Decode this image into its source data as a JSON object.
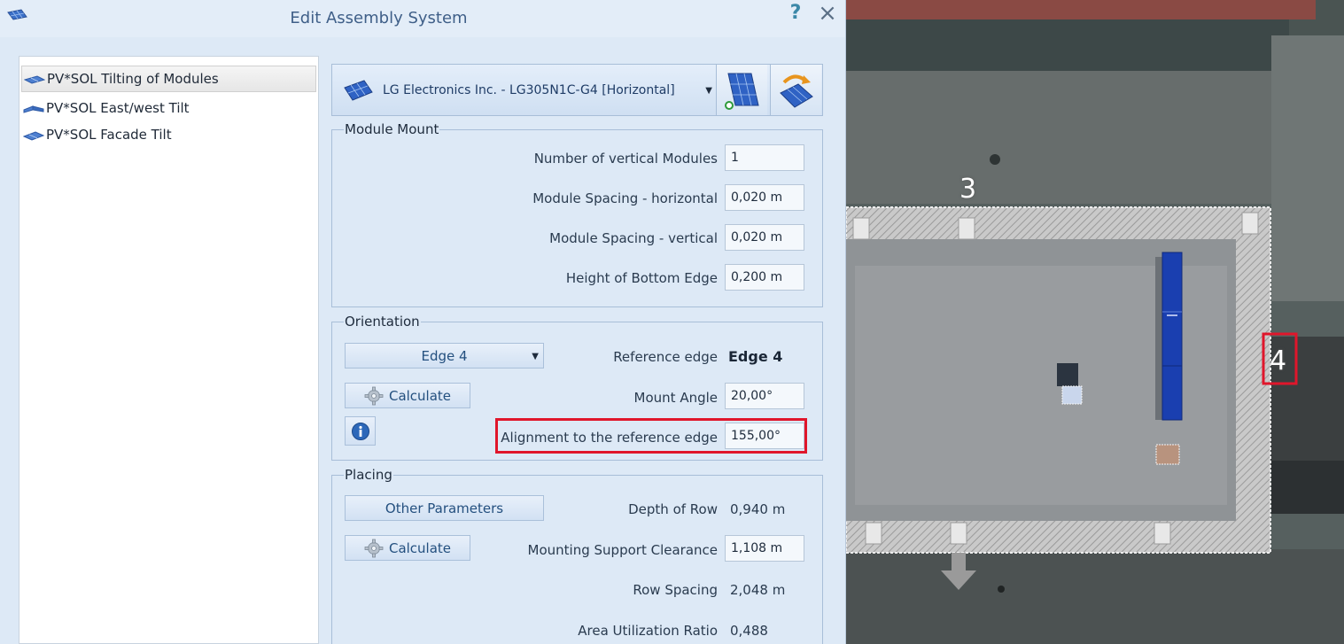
{
  "window": {
    "title": "Edit Assembly System",
    "help_label": "?",
    "close_label": "×"
  },
  "sidebar": {
    "items": [
      {
        "label": "PV*SOL Tilting of Modules",
        "selected": true
      },
      {
        "label": "PV*SOL East/west Tilt",
        "selected": false
      },
      {
        "label": "PV*SOL Facade Tilt",
        "selected": false
      }
    ]
  },
  "module": {
    "selected": "LG Electronics Inc. - LG305N1C-G4 [Horizontal]"
  },
  "module_mount": {
    "title": "Module Mount",
    "fields": [
      {
        "label": "Number of vertical Modules",
        "value": "1"
      },
      {
        "label": "Module Spacing - horizontal",
        "value": "0,020 m"
      },
      {
        "label": "Module Spacing - vertical",
        "value": "0,020 m"
      },
      {
        "label": "Height of Bottom Edge",
        "value": "0,200 m"
      }
    ]
  },
  "orientation": {
    "title": "Orientation",
    "edge_select": "Edge 4",
    "calculate_label": "Calculate",
    "reference_edge_label": "Reference edge",
    "reference_edge_value": "Edge 4",
    "mount_angle_label": "Mount Angle",
    "mount_angle_value": "20,00°",
    "alignment_label": "Alignment to the reference edge",
    "alignment_value": "155,00°"
  },
  "placing": {
    "title": "Placing",
    "other_params_label": "Other Parameters",
    "calculate_label": "Calculate",
    "depth_label": "Depth of Row",
    "depth_value": "0,940 m",
    "clearance_label": "Mounting Support Clearance",
    "clearance_value": "1,108 m",
    "row_spacing_label": "Row Spacing",
    "row_spacing_value": "2,048 m",
    "utilization_label": "Area Utilization Ratio",
    "utilization_value": "0,488"
  },
  "map": {
    "edge_3_label": "3",
    "edge_4_label": "4"
  },
  "colors": {
    "accent": "#24507f",
    "highlight": "#e0162b",
    "module_blue": "#1a3fb0"
  }
}
